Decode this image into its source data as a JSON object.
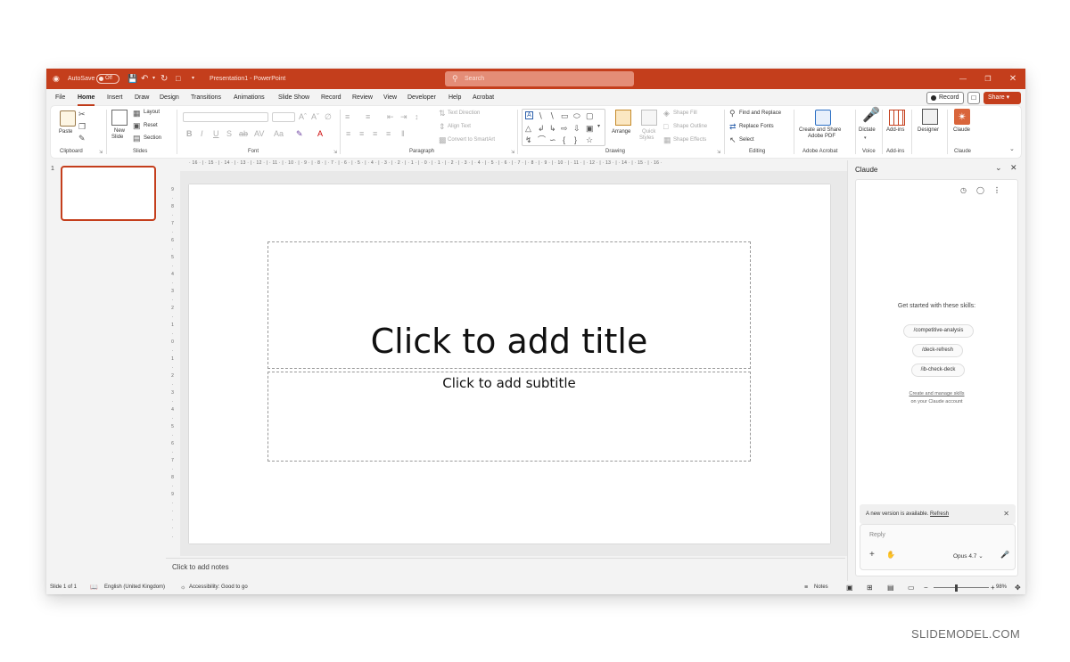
{
  "titlebar": {
    "autosave_label": "AutoSave",
    "autosave_state": "Off",
    "document_title": "Presentation1 - PowerPoint",
    "search_placeholder": "Search",
    "accent_color": "#c43e1c"
  },
  "menu": {
    "tabs": [
      "File",
      "Home",
      "Insert",
      "Draw",
      "Design",
      "Transitions",
      "Animations",
      "Slide Show",
      "Record",
      "Review",
      "View",
      "Developer",
      "Help",
      "Acrobat"
    ],
    "active_tab": "Home",
    "record_label": "Record",
    "share_label": "Share"
  },
  "ribbon": {
    "clipboard": {
      "paste": "Paste",
      "group": "Clipboard"
    },
    "slides": {
      "new_slide": "New",
      "new_slide_2": "Slide",
      "layout": "Layout",
      "reset": "Reset",
      "section": "Section",
      "group": "Slides"
    },
    "font": {
      "group": "Font"
    },
    "paragraph": {
      "text_direction": "Text Direction",
      "align_text": "Align Text",
      "convert_smartart": "Convert to SmartArt",
      "group": "Paragraph"
    },
    "drawing": {
      "arrange": "Arrange",
      "quick_styles": "Quick",
      "quick_styles_2": "Styles",
      "shape_fill": "Shape Fill",
      "shape_outline": "Shape Outline",
      "shape_effects": "Shape Effects",
      "group": "Drawing"
    },
    "editing": {
      "find_replace": "Find and Replace",
      "replace_fonts": "Replace Fonts",
      "select": "Select",
      "group": "Editing"
    },
    "acrobat": {
      "create_share": "Create and Share",
      "create_share_2": "Adobe PDF",
      "group": "Adobe Acrobat"
    },
    "voice": {
      "dictate": "Dictate",
      "group": "Voice"
    },
    "addins": {
      "addins": "Add-ins",
      "group": "Add-ins"
    },
    "designer": {
      "designer": "Designer"
    },
    "claude": {
      "claude": "Claude",
      "group": "Claude"
    }
  },
  "thumbnails": {
    "slide_number": "1"
  },
  "rulers": {
    "horizontal": "· 16 · | · 15 · | · 14 · | · 13 · | · 12 · | · 11 · | · 10 · | · 9 · | · 8 · | · 7 · | · 6 · | · 5 · | · 4 · | · 3 · | · 2 · | · 1 · | · 0 · | · 1 · | · 2 · | · 3 · | · 4 · | · 5 · | · 6 · | · 7 · | · 8 · | · 9 · | · 10 · | · 11 · | · 12 · | · 13 · | · 14 · | · 15 · | · 16 ·",
    "vertical": [
      "9",
      "·",
      "8",
      "·",
      "7",
      "·",
      "6",
      "·",
      "5",
      "·",
      "4",
      "·",
      "3",
      "·",
      "2",
      "·",
      "1",
      "·",
      "0",
      "·",
      "1",
      "·",
      "2",
      "·",
      "3",
      "·",
      "4",
      "·",
      "5",
      "·",
      "6",
      "·",
      "7",
      "·",
      "8",
      "·",
      "9",
      "·",
      "·",
      "·",
      "·",
      "·",
      "·",
      "·"
    ]
  },
  "slide": {
    "title_placeholder": "Click to add title",
    "subtitle_placeholder": "Click to add subtitle"
  },
  "notes": {
    "placeholder": "Click to add notes"
  },
  "claude_panel": {
    "title": "Claude",
    "heading": "Get started with these skills:",
    "skills": [
      "/competitive-analysis",
      "/deck-refresh",
      "/ib-check-deck"
    ],
    "manage_link": "Create and manage skills",
    "account_text": "on your Claude account",
    "banner_text": "A new version is available.",
    "banner_link": "Refresh",
    "reply_placeholder": "Reply",
    "model": "Opus 4.7"
  },
  "statusbar": {
    "slide_info": "Slide 1 of 1",
    "language": "English (United Kingdom)",
    "accessibility": "Accessibility: Good to go",
    "notes": "Notes",
    "zoom": "98%"
  },
  "watermark": "SLIDEMODEL.COM"
}
